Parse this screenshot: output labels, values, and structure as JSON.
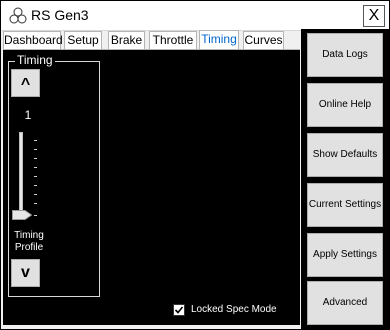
{
  "window": {
    "title": "RS Gen3",
    "close_label": "X"
  },
  "tabs": [
    {
      "label": "Dashboard",
      "active": false
    },
    {
      "label": "Setup",
      "active": false
    },
    {
      "label": "Brake",
      "active": false
    },
    {
      "label": "Throttle",
      "active": false
    },
    {
      "label": "Timing",
      "active": true
    },
    {
      "label": "Curves",
      "active": false
    }
  ],
  "timing": {
    "group_title": "Timing",
    "up_label": "^",
    "down_label": "v",
    "value": "1",
    "profile_label_line1": "Timing",
    "profile_label_line2": "Profile"
  },
  "locked_spec": {
    "label": "Locked Spec Mode",
    "checked": true
  },
  "side_buttons": [
    {
      "label": "Data Logs"
    },
    {
      "label": "Online Help"
    },
    {
      "label": "Show Defaults"
    },
    {
      "label": "Current Settings"
    },
    {
      "label": "Apply Settings"
    },
    {
      "label": "Advanced"
    }
  ],
  "colors": {
    "active_tab_text": "#0066cc",
    "panel_background": "#000000",
    "button_face": "#e1e1e1"
  },
  "icons": {
    "app": "app-logo-icon",
    "close": "close-icon",
    "checkbox": "checkmark-icon"
  }
}
